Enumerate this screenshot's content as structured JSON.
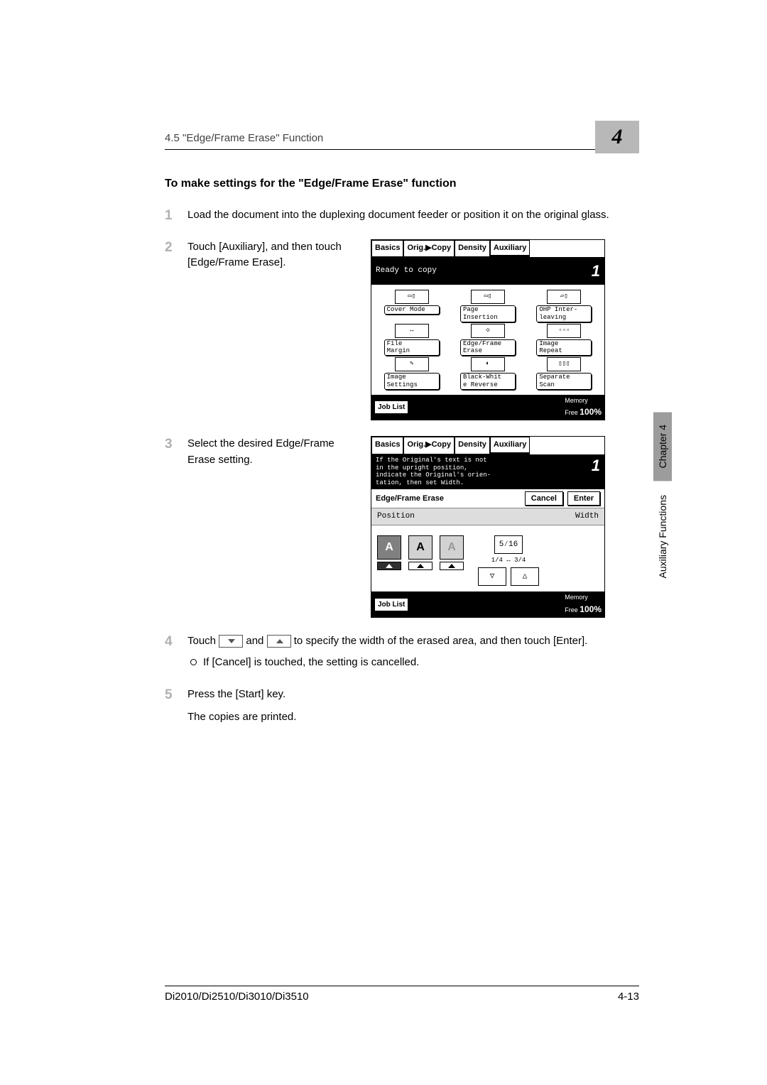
{
  "header": {
    "section_title": "4.5 \"Edge/Frame Erase\" Function",
    "chapter_number": "4"
  },
  "headline": "To make settings for the \"Edge/Frame Erase\" function",
  "steps": {
    "s1": {
      "num": "1",
      "text": "Load the document into the duplexing document feeder or position it on the original glass."
    },
    "s2": {
      "num": "2",
      "text": "Touch [Auxiliary], and then touch [Edge/Frame Erase]."
    },
    "s3": {
      "num": "3",
      "text": "Select the desired Edge/Frame Erase setting."
    },
    "s4": {
      "num": "4",
      "text_a": "Touch ",
      "text_b": " and ",
      "text_c": " to specify the width of the erased area, and then touch [Enter].",
      "sub": "If [Cancel] is touched, the setting is cancelled."
    },
    "s5": {
      "num": "5",
      "text_a": "Press the [Start] key.",
      "text_b": "The copies are printed."
    }
  },
  "lcd1": {
    "tabs": {
      "basics": "Basics",
      "orig": "Orig.▶Copy",
      "density": "Density",
      "aux": "Auxiliary"
    },
    "status": "Ready to copy",
    "count": "1",
    "buttons": {
      "cover": "Cover Mode",
      "page": "Page\nInsertion",
      "ohp": "OHP Inter-\nleaving",
      "file": "File\nMargin",
      "edge": "Edge/Frame\nErase",
      "repeat": "Image\nRepeat",
      "img": "Image\nSettings",
      "bw": "Black-Whit\ne Reverse",
      "scan": "Separate\nScan"
    },
    "footer": {
      "job": "Job List",
      "mem_label": "Memory\nFree",
      "mem_val": "100%"
    }
  },
  "lcd2": {
    "tabs": {
      "basics": "Basics",
      "orig": "Orig.▶Copy",
      "density": "Density",
      "aux": "Auxiliary"
    },
    "msg": "If the Original's text is not\nin the upright position,\nindicate the Original's orien-\ntation, then set Width.",
    "count": "1",
    "efe": "Edge/Frame Erase",
    "cancel": "Cancel",
    "enter": "Enter",
    "position": "Position",
    "width": "Width",
    "a": "A",
    "fraction_disp": "5⁄16",
    "range": "1/4 ↔ 3/4",
    "footer": {
      "job": "Job List",
      "mem_label": "Memory\nFree",
      "mem_val": "100%"
    }
  },
  "side": {
    "chapter": "Chapter 4",
    "aux": "Auxiliary Functions"
  },
  "footer": {
    "model": "Di2010/Di2510/Di3010/Di3510",
    "page": "4-13"
  }
}
